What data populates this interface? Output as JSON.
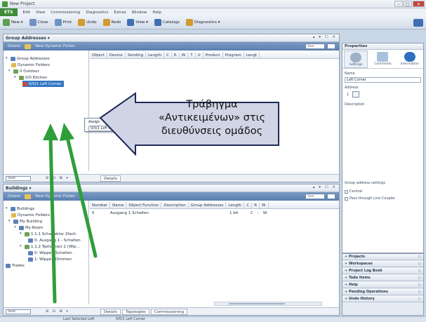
{
  "window": {
    "title": "New Project"
  },
  "menu": {
    "etp": "ETS",
    "items": [
      "Edit",
      "View",
      "Commissioning",
      "Diagnostics",
      "Extras",
      "Window",
      "Help"
    ]
  },
  "toolbar": {
    "items": [
      {
        "label": "New ▾",
        "icon": "new-icon"
      },
      {
        "label": "Close",
        "icon": "close-project-icon"
      },
      {
        "label": "Print",
        "icon": "print-icon"
      },
      {
        "label": "Undo",
        "icon": "undo-icon"
      },
      {
        "label": "Redo",
        "icon": "redo-icon"
      },
      {
        "label": "View ▾",
        "icon": "view-icon"
      },
      {
        "label": "Catalogs",
        "icon": "catalog-icon"
      },
      {
        "label": "Diagnostics ▾",
        "icon": "diagnostics-icon"
      }
    ]
  },
  "group_pane": {
    "title": "Group Addresses ▾",
    "buttons": "▴ ▾ ☐ ✕",
    "toolbar": {
      "add_label": "Delete",
      "new_folder": "New Dynamic Folder",
      "search_placeholder": "Sea"
    },
    "tree": [
      {
        "label": "Group Addresses",
        "level": 0,
        "icon": "group-addresses-icon"
      },
      {
        "label": "Dynamic Folders",
        "level": 1,
        "icon": "folder-icon"
      },
      {
        "label": "0 Outdoor",
        "level": 1,
        "icon": "main-group-icon"
      },
      {
        "label": "0/0 Kitchen",
        "level": 2,
        "icon": "middle-group-icon"
      },
      {
        "label": "0/0/1 Left Corner",
        "level": 3,
        "icon": "group-address-icon",
        "selected": true
      }
    ],
    "columns": [
      "Object",
      "Device",
      "Sending",
      "Length",
      "C",
      "R",
      "W",
      "T",
      "U",
      "Product",
      "Program",
      "Lengt"
    ],
    "footer_tabs": [
      "Details"
    ],
    "search_placeholder": "Sear"
  },
  "building_pane": {
    "title": "Buildings ▾",
    "buttons": "▴ ▾ ☐ ✕",
    "toolbar": {
      "add_label": "Delete",
      "new_folder": "New Dynamic Folder",
      "search_placeholder": "Sea"
    },
    "tree": [
      {
        "label": "Buildings",
        "level": 0,
        "icon": "building-icon"
      },
      {
        "label": "Dynamic Folders",
        "level": 1,
        "icon": "folder-icon"
      },
      {
        "label": "My Building",
        "level": 1,
        "icon": "house-icon"
      },
      {
        "label": "My Room",
        "level": 2,
        "icon": "room-icon"
      },
      {
        "label": "1.1.1 Schaltaktor 2fach",
        "level": 3,
        "icon": "device-icon"
      },
      {
        "label": "0: Ausgang 1 - Schalten",
        "level": 4,
        "icon": "object-icon"
      },
      {
        "label": "1.1.2 Tastsensor 2 (Wip...",
        "level": 3,
        "icon": "device-icon"
      },
      {
        "label": "0: Wippe - Schalten",
        "level": 4,
        "icon": "object-icon"
      },
      {
        "label": "1: Wippe - Dimmen",
        "level": 4,
        "icon": "object-icon"
      },
      {
        "label": "Trades",
        "level": 0,
        "icon": "trades-icon"
      }
    ],
    "columns": [
      "Number",
      "Name",
      "Object Function",
      "Description",
      "Group Addresses",
      "Length",
      "C",
      "R",
      "W"
    ],
    "row": {
      "number": "0",
      "name": "Ausgang 1 Schalten",
      "length": "1 bit",
      "c": "C",
      "r": "-",
      "w": "W"
    },
    "footer_tabs": [
      "Details",
      "Topologies",
      "Commissioning"
    ],
    "search_placeholder": "Sear"
  },
  "properties": {
    "title": "Properties",
    "tabs": [
      {
        "label": "Settings",
        "icon": "settings-icon",
        "active": true
      },
      {
        "label": "Comments",
        "icon": "comments-icon"
      },
      {
        "label": "Information",
        "icon": "information-icon"
      }
    ],
    "name_label": "Name",
    "name_value": "Left Corner",
    "address_label": "Address",
    "address_value": "1",
    "description_label": "Description",
    "settings_label": "Group address settings",
    "check_central": "Central",
    "check_pass": "Pass through Line Coupler"
  },
  "side_panels": [
    "Projects",
    "Workspaces",
    "Project Log Book",
    "Todo Items",
    "Help",
    "Pending Operations",
    "Undo History"
  ],
  "drag_popup": {
    "line1": "Assign",
    "line2": "0/0/1 Left Corner"
  },
  "statusbar": {
    "left": "Last Selected Left",
    "right": "0/0/1 Left Corner"
  },
  "callout": {
    "text": "Τράβηγμα «Αντικειμένων» στις διευθύνσεις ομάδος"
  },
  "colors": {
    "arrow_green": "#2f9e3a",
    "callout_fill": "#d0d4e4",
    "callout_stroke": "#1f2a5a"
  }
}
